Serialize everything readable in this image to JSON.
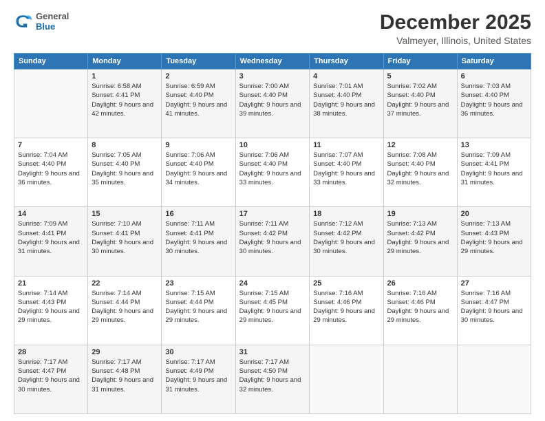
{
  "logo": {
    "general": "General",
    "blue": "Blue"
  },
  "header": {
    "title": "December 2025",
    "subtitle": "Valmeyer, Illinois, United States"
  },
  "weekdays": [
    "Sunday",
    "Monday",
    "Tuesday",
    "Wednesday",
    "Thursday",
    "Friday",
    "Saturday"
  ],
  "weeks": [
    [
      {
        "day": "",
        "sunrise": "",
        "sunset": "",
        "daylight": ""
      },
      {
        "day": "1",
        "sunrise": "Sunrise: 6:58 AM",
        "sunset": "Sunset: 4:41 PM",
        "daylight": "Daylight: 9 hours and 42 minutes."
      },
      {
        "day": "2",
        "sunrise": "Sunrise: 6:59 AM",
        "sunset": "Sunset: 4:40 PM",
        "daylight": "Daylight: 9 hours and 41 minutes."
      },
      {
        "day": "3",
        "sunrise": "Sunrise: 7:00 AM",
        "sunset": "Sunset: 4:40 PM",
        "daylight": "Daylight: 9 hours and 39 minutes."
      },
      {
        "day": "4",
        "sunrise": "Sunrise: 7:01 AM",
        "sunset": "Sunset: 4:40 PM",
        "daylight": "Daylight: 9 hours and 38 minutes."
      },
      {
        "day": "5",
        "sunrise": "Sunrise: 7:02 AM",
        "sunset": "Sunset: 4:40 PM",
        "daylight": "Daylight: 9 hours and 37 minutes."
      },
      {
        "day": "6",
        "sunrise": "Sunrise: 7:03 AM",
        "sunset": "Sunset: 4:40 PM",
        "daylight": "Daylight: 9 hours and 36 minutes."
      }
    ],
    [
      {
        "day": "7",
        "sunrise": "Sunrise: 7:04 AM",
        "sunset": "Sunset: 4:40 PM",
        "daylight": "Daylight: 9 hours and 36 minutes."
      },
      {
        "day": "8",
        "sunrise": "Sunrise: 7:05 AM",
        "sunset": "Sunset: 4:40 PM",
        "daylight": "Daylight: 9 hours and 35 minutes."
      },
      {
        "day": "9",
        "sunrise": "Sunrise: 7:06 AM",
        "sunset": "Sunset: 4:40 PM",
        "daylight": "Daylight: 9 hours and 34 minutes."
      },
      {
        "day": "10",
        "sunrise": "Sunrise: 7:06 AM",
        "sunset": "Sunset: 4:40 PM",
        "daylight": "Daylight: 9 hours and 33 minutes."
      },
      {
        "day": "11",
        "sunrise": "Sunrise: 7:07 AM",
        "sunset": "Sunset: 4:40 PM",
        "daylight": "Daylight: 9 hours and 33 minutes."
      },
      {
        "day": "12",
        "sunrise": "Sunrise: 7:08 AM",
        "sunset": "Sunset: 4:40 PM",
        "daylight": "Daylight: 9 hours and 32 minutes."
      },
      {
        "day": "13",
        "sunrise": "Sunrise: 7:09 AM",
        "sunset": "Sunset: 4:41 PM",
        "daylight": "Daylight: 9 hours and 31 minutes."
      }
    ],
    [
      {
        "day": "14",
        "sunrise": "Sunrise: 7:09 AM",
        "sunset": "Sunset: 4:41 PM",
        "daylight": "Daylight: 9 hours and 31 minutes."
      },
      {
        "day": "15",
        "sunrise": "Sunrise: 7:10 AM",
        "sunset": "Sunset: 4:41 PM",
        "daylight": "Daylight: 9 hours and 30 minutes."
      },
      {
        "day": "16",
        "sunrise": "Sunrise: 7:11 AM",
        "sunset": "Sunset: 4:41 PM",
        "daylight": "Daylight: 9 hours and 30 minutes."
      },
      {
        "day": "17",
        "sunrise": "Sunrise: 7:11 AM",
        "sunset": "Sunset: 4:42 PM",
        "daylight": "Daylight: 9 hours and 30 minutes."
      },
      {
        "day": "18",
        "sunrise": "Sunrise: 7:12 AM",
        "sunset": "Sunset: 4:42 PM",
        "daylight": "Daylight: 9 hours and 30 minutes."
      },
      {
        "day": "19",
        "sunrise": "Sunrise: 7:13 AM",
        "sunset": "Sunset: 4:42 PM",
        "daylight": "Daylight: 9 hours and 29 minutes."
      },
      {
        "day": "20",
        "sunrise": "Sunrise: 7:13 AM",
        "sunset": "Sunset: 4:43 PM",
        "daylight": "Daylight: 9 hours and 29 minutes."
      }
    ],
    [
      {
        "day": "21",
        "sunrise": "Sunrise: 7:14 AM",
        "sunset": "Sunset: 4:43 PM",
        "daylight": "Daylight: 9 hours and 29 minutes."
      },
      {
        "day": "22",
        "sunrise": "Sunrise: 7:14 AM",
        "sunset": "Sunset: 4:44 PM",
        "daylight": "Daylight: 9 hours and 29 minutes."
      },
      {
        "day": "23",
        "sunrise": "Sunrise: 7:15 AM",
        "sunset": "Sunset: 4:44 PM",
        "daylight": "Daylight: 9 hours and 29 minutes."
      },
      {
        "day": "24",
        "sunrise": "Sunrise: 7:15 AM",
        "sunset": "Sunset: 4:45 PM",
        "daylight": "Daylight: 9 hours and 29 minutes."
      },
      {
        "day": "25",
        "sunrise": "Sunrise: 7:16 AM",
        "sunset": "Sunset: 4:46 PM",
        "daylight": "Daylight: 9 hours and 29 minutes."
      },
      {
        "day": "26",
        "sunrise": "Sunrise: 7:16 AM",
        "sunset": "Sunset: 4:46 PM",
        "daylight": "Daylight: 9 hours and 29 minutes."
      },
      {
        "day": "27",
        "sunrise": "Sunrise: 7:16 AM",
        "sunset": "Sunset: 4:47 PM",
        "daylight": "Daylight: 9 hours and 30 minutes."
      }
    ],
    [
      {
        "day": "28",
        "sunrise": "Sunrise: 7:17 AM",
        "sunset": "Sunset: 4:47 PM",
        "daylight": "Daylight: 9 hours and 30 minutes."
      },
      {
        "day": "29",
        "sunrise": "Sunrise: 7:17 AM",
        "sunset": "Sunset: 4:48 PM",
        "daylight": "Daylight: 9 hours and 31 minutes."
      },
      {
        "day": "30",
        "sunrise": "Sunrise: 7:17 AM",
        "sunset": "Sunset: 4:49 PM",
        "daylight": "Daylight: 9 hours and 31 minutes."
      },
      {
        "day": "31",
        "sunrise": "Sunrise: 7:17 AM",
        "sunset": "Sunset: 4:50 PM",
        "daylight": "Daylight: 9 hours and 32 minutes."
      },
      {
        "day": "",
        "sunrise": "",
        "sunset": "",
        "daylight": ""
      },
      {
        "day": "",
        "sunrise": "",
        "sunset": "",
        "daylight": ""
      },
      {
        "day": "",
        "sunrise": "",
        "sunset": "",
        "daylight": ""
      }
    ]
  ]
}
